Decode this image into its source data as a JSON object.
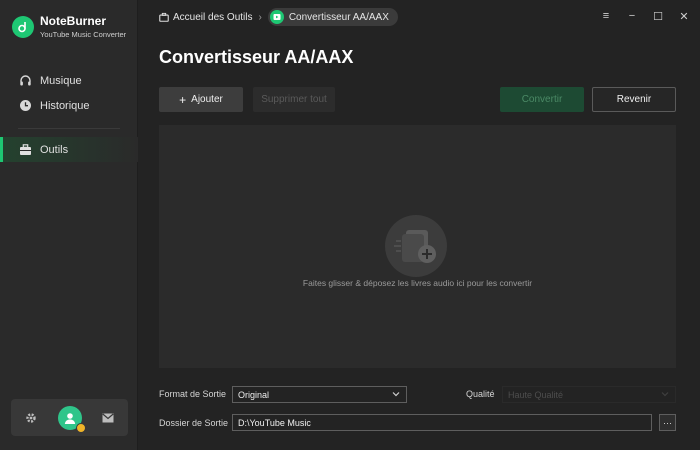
{
  "app": {
    "name": "NoteBurner",
    "subtitle": "YouTube Music Converter"
  },
  "sidebar": {
    "items": [
      {
        "label": "Musique",
        "icon": "headphones-icon"
      },
      {
        "label": "Historique",
        "icon": "clock-icon"
      },
      {
        "label": "Outils",
        "icon": "toolbox-icon",
        "active": true
      }
    ]
  },
  "breadcrumb": {
    "home": "Accueil des Outils",
    "current": "Convertisseur AA/AAX"
  },
  "page": {
    "title": "Convertisseur AA/AAX"
  },
  "toolbar": {
    "add_label": "Ajouter",
    "delete_label": "Supprimer tout",
    "convert_label": "Convertir",
    "back_label": "Revenir"
  },
  "dropzone": {
    "hint": "Faites glisser & déposez les livres audio ici pour les convertir"
  },
  "settings": {
    "format_label": "Format de Sortie",
    "format_value": "Original",
    "quality_label": "Qualité",
    "quality_value": "Haute Qualité",
    "folder_label": "Dossier de Sortie",
    "folder_value": "D:\\YouTube Music",
    "more_label": "···"
  },
  "colors": {
    "accent": "#1ec773",
    "background": "#232323",
    "sidebar": "#2a2a2a"
  }
}
